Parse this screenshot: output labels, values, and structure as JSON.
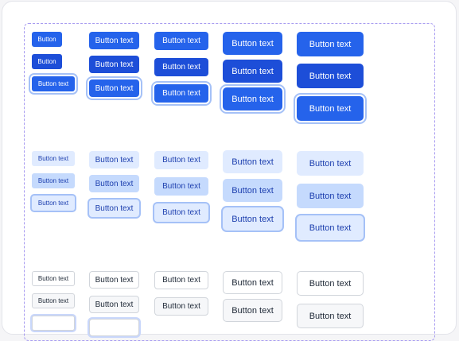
{
  "button_label": "Button text",
  "button_label_small": "Button",
  "colors": {
    "primary": "#2563eb",
    "primary_hover": "#1d4ed8",
    "secondary": "#e0ebff",
    "secondary_hover": "#c5dafd",
    "tertiary_border": "#d1d5db",
    "frame_dashed": "#a79bf0"
  },
  "variants": [
    "primary",
    "secondary",
    "tertiary"
  ],
  "states": [
    "default",
    "hover",
    "focus"
  ],
  "sizes": [
    "xs",
    "sm",
    "md",
    "lg",
    "xl"
  ]
}
